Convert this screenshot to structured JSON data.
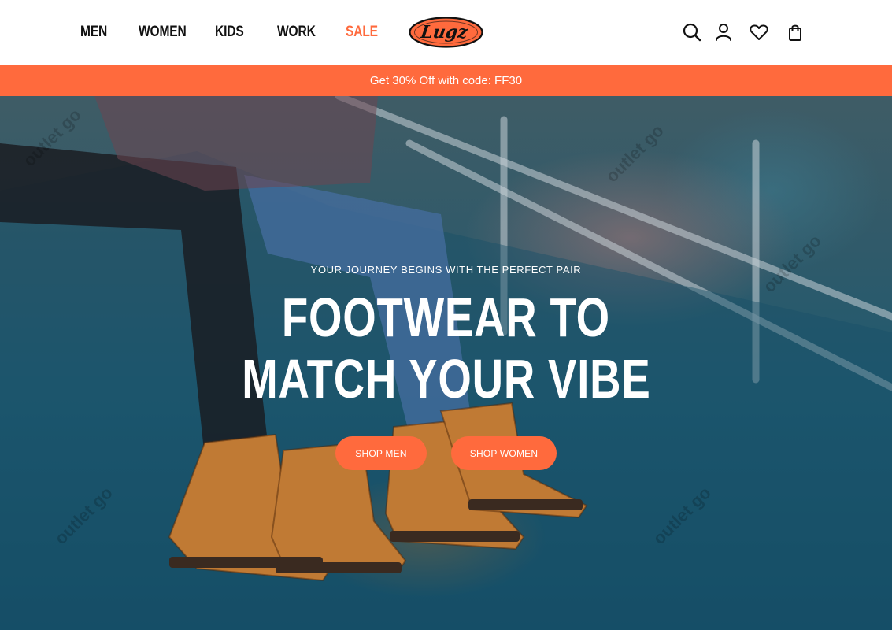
{
  "colors": {
    "accent": "#FF6A3D",
    "text_dark": "#111111",
    "white": "#FFFFFF"
  },
  "nav": {
    "items": [
      {
        "label": "MEN"
      },
      {
        "label": "WOMEN"
      },
      {
        "label": "KIDS"
      },
      {
        "label": "WORK"
      },
      {
        "label": "SALE"
      }
    ]
  },
  "logo": {
    "text": "Lugz"
  },
  "header_icons": [
    "search-icon",
    "account-icon",
    "wishlist-heart-icon",
    "shopping-bag-icon"
  ],
  "promo": {
    "text": "Get 30% Off with code: FF30"
  },
  "hero": {
    "eyebrow": "YOUR JOURNEY BEGINS WITH THE PERFECT PAIR",
    "headline_line1": "FOOTWEAR TO",
    "headline_line2": "MATCH YOUR VIBE",
    "cta_men": "SHOP MEN",
    "cta_women": "SHOP WOMEN"
  },
  "watermark": {
    "text": "outlet go"
  }
}
